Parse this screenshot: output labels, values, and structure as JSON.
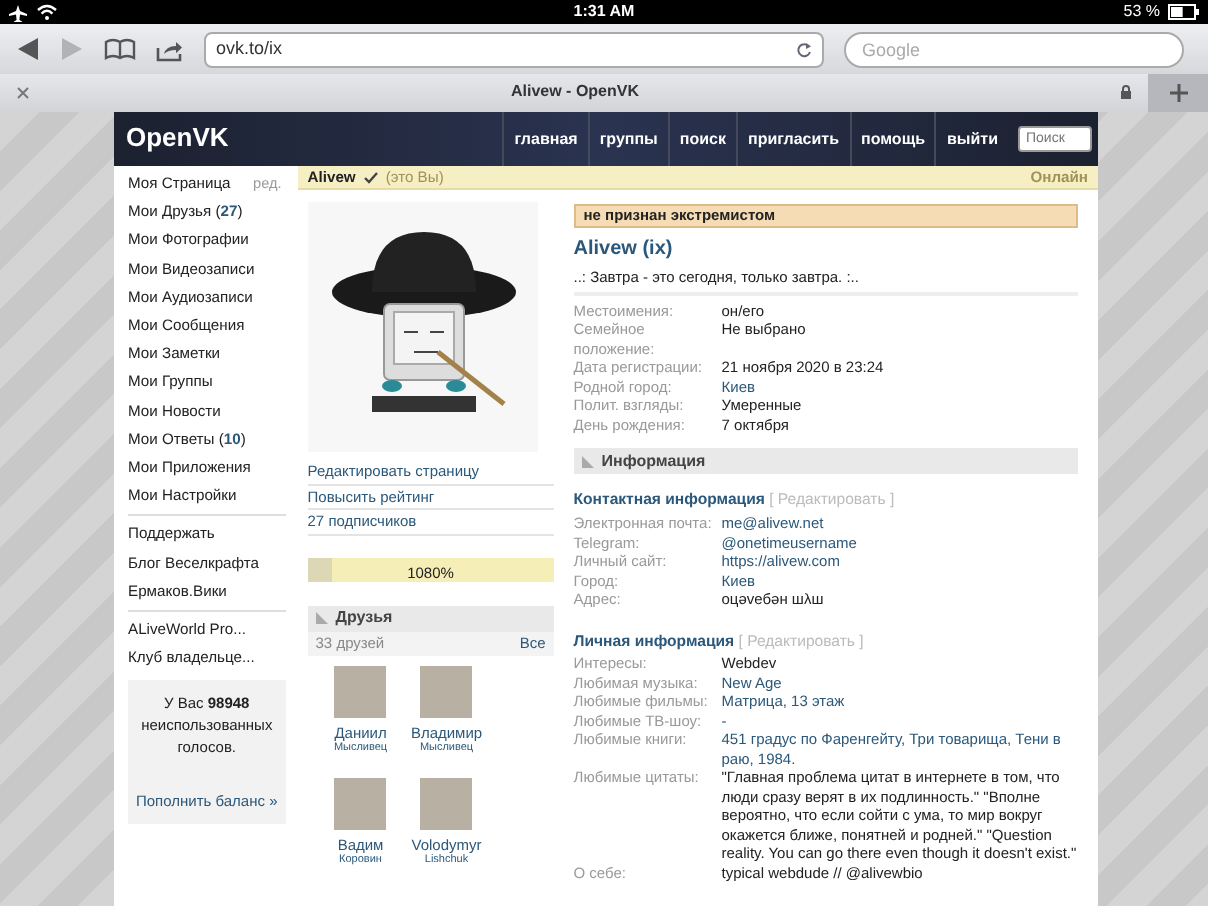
{
  "status_bar": {
    "time": "1:31 AM",
    "battery": "53 %"
  },
  "browser": {
    "url": "ovk.to/ix",
    "search_placeholder": "Google",
    "forward_enabled": false,
    "tab_title": "Alivew - OpenVK"
  },
  "header": {
    "logo": "OpenVK",
    "nav": [
      "главная",
      "группы",
      "поиск",
      "пригласить",
      "помощь",
      "выйти"
    ],
    "search_placeholder": "Поиск"
  },
  "sidebar": {
    "groups": [
      [
        {
          "label": "Моя Страница",
          "extra": "ред."
        },
        {
          "label": "Мои Друзья (**27**)"
        },
        {
          "label": "Мои Фотографии"
        },
        {
          "label": "Мои Видеозаписи"
        },
        {
          "label": "Мои Аудиозаписи"
        },
        {
          "label": "Мои Сообщения"
        },
        {
          "label": "Мои Заметки"
        },
        {
          "label": "Мои Группы"
        },
        {
          "label": "Мои Новости"
        },
        {
          "label": "Мои Ответы (**10**)"
        },
        {
          "label": "Мои Приложения"
        },
        {
          "label": "Мои Настройки"
        }
      ],
      [
        {
          "label": "Поддержать"
        },
        {
          "label": "Блог Веселкрафта"
        },
        {
          "label": "Ермаков.Вики"
        }
      ],
      [
        {
          "label": "ALiveWorld Pro..."
        },
        {
          "label": "Клуб владельце..."
        }
      ]
    ],
    "votes": {
      "text": "У Вас **98948** неиспользованных голосов.",
      "link": "Пополнить баланс »"
    }
  },
  "profile_bar": {
    "name": "Alivew",
    "verified": true,
    "note": "(это Вы)",
    "status": "Онлайн"
  },
  "actions": [
    "Редактировать страницу",
    "Повысить рейтинг",
    "27 подписчиков"
  ],
  "rating": {
    "level": 0.1,
    "text": "1080%"
  },
  "friends": {
    "title": "Друзья",
    "count": "33 друзей",
    "all": "Все",
    "items": [
      {
        "first": "Даниил",
        "last": "Мысливец"
      },
      {
        "first": "Владимир",
        "last": "Мысливец"
      },
      {
        "first": "Вадим",
        "last": "Коровин"
      },
      {
        "first": "Volodymyr",
        "last": "Lishchuk"
      }
    ]
  },
  "notice": "не признан экстремистом",
  "name": "Alivew (ix)",
  "status": "..: Завтра - это сегодня, только завтра. :..",
  "main_info": [
    {
      "label": "Местоимения:",
      "value": "он/его",
      "link": false
    },
    {
      "label": "Семейное положение:",
      "value": "Не выбрано",
      "link": false
    },
    {
      "label": "Дата регистрации:",
      "value": "21 ноября 2020 в 23:24",
      "link": false
    },
    {
      "label": "Родной город:",
      "value": "Киев",
      "link": true
    },
    {
      "label": "Полит. взгляды:",
      "value": "Умеренные",
      "link": false
    },
    {
      "label": "День рождения:",
      "value": "7 октября",
      "link": false
    }
  ],
  "info_section": {
    "title": "Информация",
    "groups": [
      {
        "title": "Контактная информация",
        "edit": "[ Редактировать ]",
        "rows": [
          {
            "label": "Электронная почта:",
            "value": "me@alivew.net",
            "link": true
          },
          {
            "label": "Telegram:",
            "value": "@onetimeusername",
            "link": true
          },
          {
            "label": "Личный сайт:",
            "value": "https://alivew.com",
            "link": true
          },
          {
            "label": "Город:",
            "value": "Киев",
            "link": true
          },
          {
            "label": "Адрес:",
            "value": "оцəvебəн шλш",
            "link": false
          }
        ]
      },
      {
        "title": "Личная информация",
        "edit": "[ Редактировать ]",
        "rows": [
          {
            "label": "Интересы:",
            "value": "Webdev",
            "link": false
          },
          {
            "label": "Любимая музыка:",
            "value": "New Age",
            "link": true
          },
          {
            "label": "Любимые фильмы:",
            "value": "Матрица, 13 этаж",
            "link": true
          },
          {
            "label": "Любимые ТВ-шоу:",
            "value": "-",
            "link": true
          },
          {
            "label": "Любимые книги:",
            "value": "451 градус по Фаренгейту, Три товарища, Тени в раю, 1984.",
            "link": true
          },
          {
            "label": "Любимые цитаты:",
            "value": "\"Главная проблема цитат в интернете в том, что люди сразу верят в их подлинность.\" \"Вполне вероятно, что если сойти с ума, то мир вокруг окажется ближе, понятней и родней.\" \"Question reality. You can go there even though it doesn't exist.\"",
            "link": false
          },
          {
            "label": "О себе:",
            "value": "typical webdude // @alivewbio",
            "link": false
          }
        ]
      }
    ]
  }
}
